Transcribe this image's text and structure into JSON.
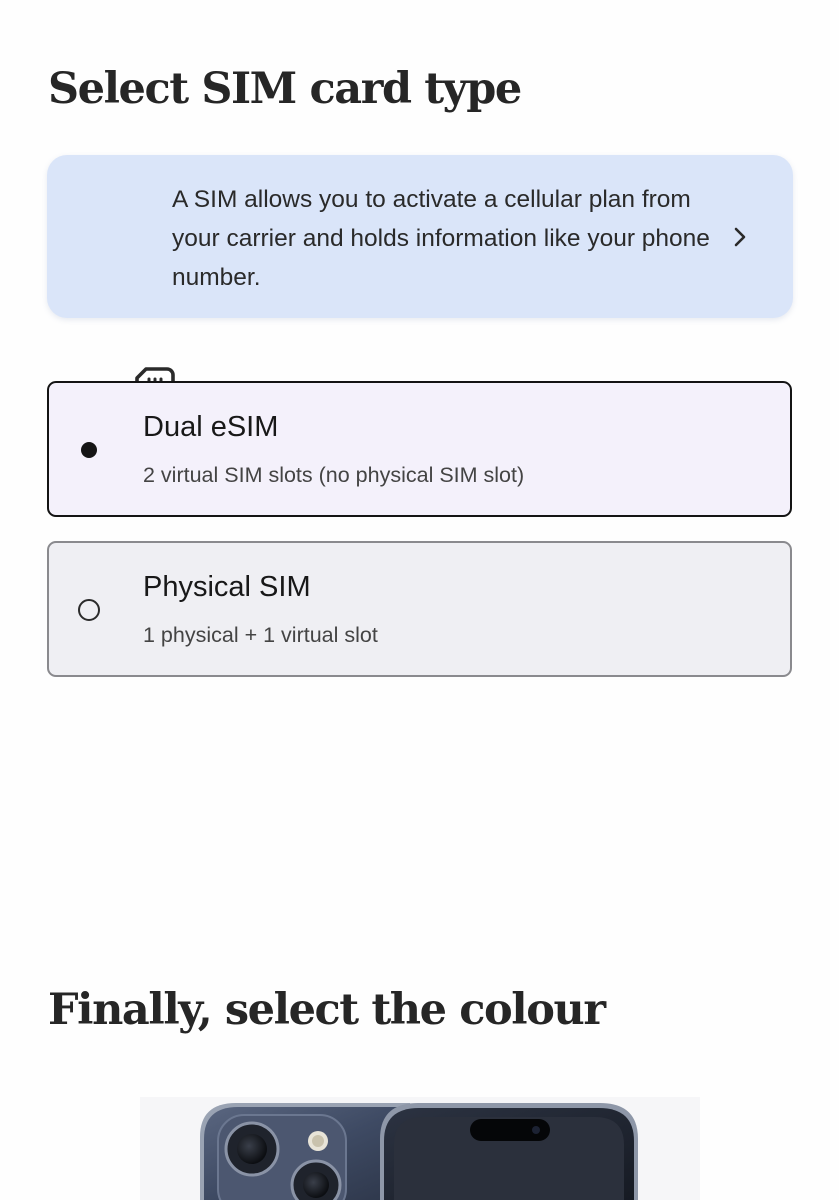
{
  "sim_section": {
    "title": "Select SIM card type",
    "info": {
      "icon": "sim-card-icon",
      "text": "A SIM allows you to activate a cellular plan from your carrier and holds information like your phone number.",
      "chevron_icon": "chevron-right-icon",
      "background": "#dae5f9"
    },
    "options": [
      {
        "title": "Dual eSIM",
        "subtitle": "2 virtual SIM slots (no physical SIM slot)",
        "selected": true
      },
      {
        "title": "Physical SIM",
        "subtitle": "1 physical + 1 virtual slot",
        "selected": false
      }
    ]
  },
  "colour_section": {
    "title": "Finally, select the colour",
    "product_image": "phone-product-image"
  },
  "colors": {
    "selected_border": "#141414",
    "selected_background": "#f4f1fb",
    "unselected_border": "#8a8a8e",
    "unselected_background": "#efeff3"
  }
}
